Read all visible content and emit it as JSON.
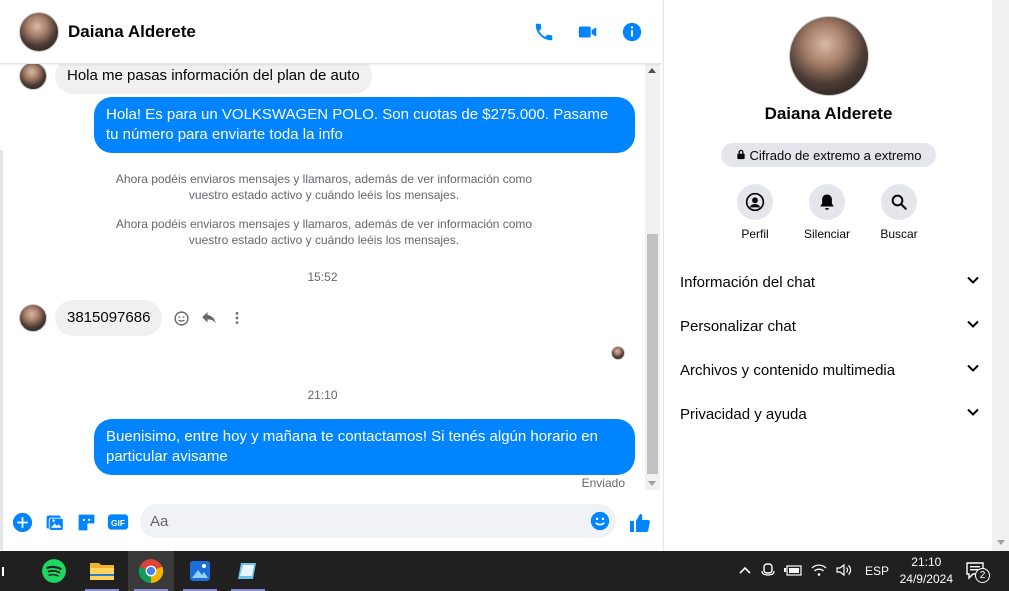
{
  "header": {
    "contact_name": "Daiana Alderete"
  },
  "messages": {
    "in_1": "Hola me pasas información del plan de auto",
    "out_1": "Hola! Es para un VOLKSWAGEN POLO. Son cuotas de $275.000. Pasame tu número para enviarte toda la info",
    "sys_1": "Ahora podéis enviaros mensajes y llamaros, además de ver información como vuestro estado activo y cuándo leéis los mensajes.",
    "sys_2": "Ahora podéis enviaros mensajes y llamaros, además de ver información como vuestro estado activo y cuándo leéis los mensajes.",
    "time_1": "15:52",
    "in_2": "3815097686",
    "time_2": "21:10",
    "out_2": "Buenisimo, entre hoy y mañana te contactamos! Si tenés algún horario en particular avisame",
    "status": "Enviado"
  },
  "composer": {
    "placeholder": "Aa"
  },
  "info": {
    "name": "Daiana Alderete",
    "encryption": "Cifrado de extremo a extremo",
    "actions": [
      {
        "label": "Perfil",
        "icon": "profile-icon"
      },
      {
        "label": "Silenciar",
        "icon": "bell-icon"
      },
      {
        "label": "Buscar",
        "icon": "search-icon"
      }
    ],
    "sections": [
      "Información del chat",
      "Personalizar chat",
      "Archivos y contenido multimedia",
      "Privacidad y ayuda"
    ]
  },
  "taskbar": {
    "language": "ESP",
    "time": "21:10",
    "date": "24/9/2024",
    "notifications": "2"
  },
  "colors": {
    "accent": "#0084ff",
    "bubble_in": "#f0f0f0",
    "taskbar": "#202020"
  }
}
